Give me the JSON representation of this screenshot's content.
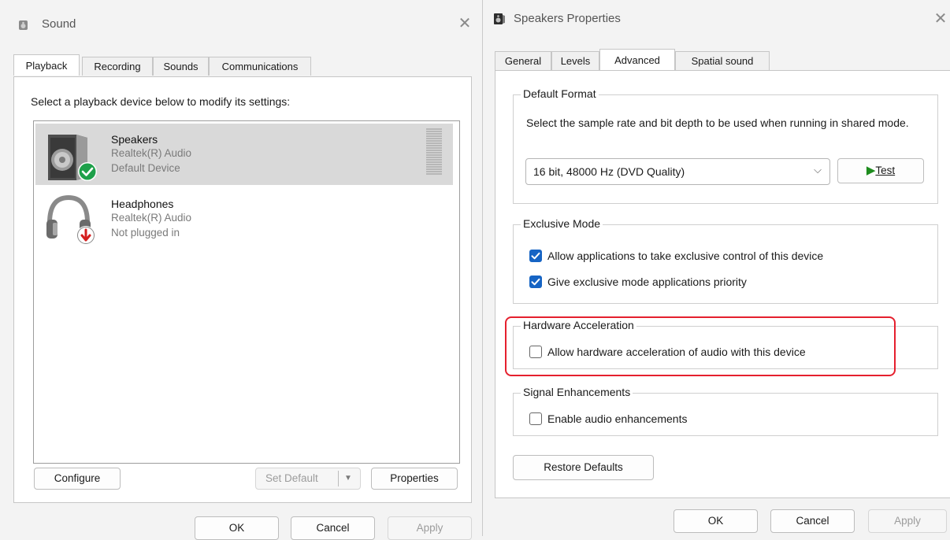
{
  "sound_window": {
    "title": "Sound",
    "tabs": [
      "Playback",
      "Recording",
      "Sounds",
      "Communications"
    ],
    "instruction": "Select a playback device below to modify its settings:",
    "devices": [
      {
        "name": "Speakers",
        "driver": "Realtek(R) Audio",
        "status": "Default Device"
      },
      {
        "name": "Headphones",
        "driver": "Realtek(R) Audio",
        "status": "Not plugged in"
      }
    ],
    "buttons": {
      "configure": "Configure",
      "set_default": "Set Default",
      "properties": "Properties"
    },
    "footer": {
      "ok": "OK",
      "cancel": "Cancel",
      "apply": "Apply"
    }
  },
  "speakers_window": {
    "title": "Speakers Properties",
    "tabs": [
      "General",
      "Levels",
      "Advanced",
      "Spatial sound"
    ],
    "default_format": {
      "legend": "Default Format",
      "description": "Select the sample rate and bit depth to be used when running in shared mode.",
      "selected_format": "16 bit, 48000 Hz (DVD Quality)",
      "test_label": "Test"
    },
    "exclusive_mode": {
      "legend": "Exclusive Mode",
      "options": [
        {
          "label": "Allow applications to take exclusive control of this device",
          "checked": true
        },
        {
          "label": "Give exclusive mode applications priority",
          "checked": true
        }
      ]
    },
    "hardware_acceleration": {
      "legend": "Hardware Acceleration",
      "option": {
        "label": "Allow hardware acceleration of audio with this device",
        "checked": false
      }
    },
    "signal_enhancements": {
      "legend": "Signal Enhancements",
      "option": {
        "label": "Enable audio enhancements",
        "checked": false
      }
    },
    "restore_defaults": "Restore Defaults",
    "footer": {
      "ok": "OK",
      "cancel": "Cancel",
      "apply": "Apply"
    }
  },
  "colors": {
    "accent": "#1664c4",
    "highlight": "#e5202e",
    "selected_row": "#d9d9d9",
    "test_arrow": "#1e8c1e"
  }
}
